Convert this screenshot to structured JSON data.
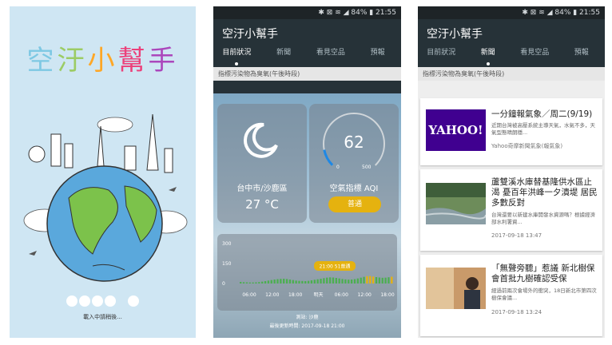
{
  "splash": {
    "title_chars": [
      "空",
      "汙",
      "小",
      "幫",
      "手"
    ],
    "title_colors": [
      "#7ec8e3",
      "#9ccc65",
      "#ffa726",
      "#ec407a",
      "#ab47bc"
    ],
    "loading_text": "載入中請稍後..."
  },
  "status": {
    "text": "✱ ⊠ ≋ ◢ 84% ▮ 21:55"
  },
  "app": {
    "title": "空汙小幫手",
    "tabs": [
      "目前狀況",
      "新聞",
      "看見空品",
      "預報"
    ]
  },
  "current": {
    "subheader": "指標污染物為臭氧(午後時段)",
    "location": "台中市/沙鹿區",
    "temperature": "27 °C",
    "aqi_value": "62",
    "aqi_min": "0",
    "aqi_max": "500",
    "aqi_fraction": 0.124,
    "aqi_label": "空氣指標 AQI",
    "aqi_status": "普通",
    "aqi_status_color": "#e5b20f",
    "station": "測站: 沙鹿",
    "updated": "最後更新時間: 2017-09-18 21:00"
  },
  "chart_data": {
    "type": "bar",
    "ylim": [
      0,
      300
    ],
    "y_ticks": [
      "300",
      "150",
      "0"
    ],
    "x_tick_labels": [
      "06:00",
      "12:00",
      "18:00",
      "明天",
      "06:00",
      "12:00",
      "18:00"
    ],
    "tooltip": "21:00 51普通",
    "values": [
      12,
      10,
      9,
      8,
      8,
      9,
      11,
      14,
      18,
      22,
      26,
      30,
      33,
      35,
      36,
      34,
      30,
      26,
      22,
      20,
      19,
      18,
      20,
      24,
      28,
      32,
      36,
      40,
      44,
      46,
      45,
      42,
      38,
      34,
      31,
      29,
      30,
      33,
      38,
      44,
      50,
      55,
      56,
      52,
      48,
      45,
      43,
      44,
      47,
      51
    ]
  },
  "news": {
    "subheader": "指標污染物為臭氧(午後時段)",
    "items": [
      {
        "title": "一分鐘報氣象／周二(9/19)",
        "desc": "近期台灣被高壓系統主導天氣，水氣不多，天氣型態晴朗穩...",
        "date": "Yahoo奇摩新聞氣象(報氣象)",
        "thumb": "yahoo"
      },
      {
        "title": "蘆雙溪水庫替基隆供水區止渴 憂百年洪峰一夕潰堤 居民多數反對",
        "desc": "台灣還要以新建水庫開發水資源嗎？根據經濟部水利署資...",
        "date": "2017-09-18 13:47",
        "thumb": "river"
      },
      {
        "title": "「無聲旁聽」惹議 新北樹保會首批九樹確認受保",
        "desc": "經過前兩次會場外的衝突，18日新北市第四次樹保會議...",
        "date": "2017-09-18 13:24",
        "thumb": "meeting"
      }
    ],
    "yahoo_logo": "YAHOO!"
  }
}
